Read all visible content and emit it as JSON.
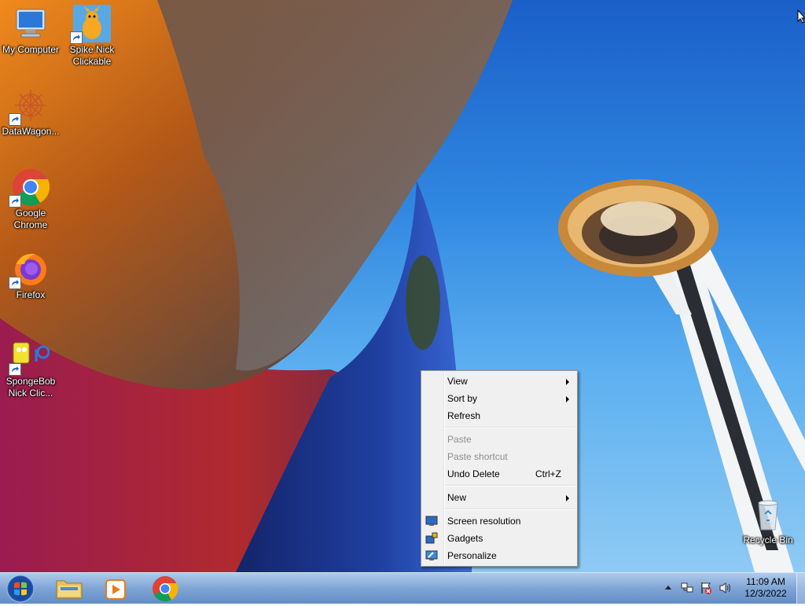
{
  "desktop": {
    "icons": [
      {
        "id": "my-computer",
        "label": "My Computer"
      },
      {
        "id": "spike-nick",
        "label": "Spike Nick\nClickable"
      },
      {
        "id": "datawagon",
        "label": "DataWagon..."
      },
      {
        "id": "google-chrome",
        "label": "Google\nChrome"
      },
      {
        "id": "firefox",
        "label": "Firefox"
      },
      {
        "id": "spongebob",
        "label": "SpongeBob\nNick Clic..."
      },
      {
        "id": "recycle-bin",
        "label": "Recycle Bin"
      }
    ]
  },
  "context_menu": {
    "items": [
      {
        "label": "View",
        "submenu": true
      },
      {
        "label": "Sort by",
        "submenu": true
      },
      {
        "label": "Refresh"
      },
      {
        "label": "Paste",
        "disabled": true
      },
      {
        "label": "Paste shortcut",
        "disabled": true
      },
      {
        "label": "Undo Delete",
        "shortcut": "Ctrl+Z"
      },
      {
        "label": "New",
        "submenu": true
      },
      {
        "label": "Screen resolution",
        "icon": "monitor-icon"
      },
      {
        "label": "Gadgets",
        "icon": "gadgets-icon"
      },
      {
        "label": "Personalize",
        "icon": "personalize-icon"
      }
    ]
  },
  "taskbar": {
    "pinned": [
      {
        "name": "windows-explorer",
        "icon": "folder-icon"
      },
      {
        "name": "windows-media-player",
        "icon": "media-player-icon"
      },
      {
        "name": "google-chrome",
        "icon": "chrome-icon"
      }
    ],
    "tray_icons": [
      "show-hidden-icons-icon",
      "network-icon",
      "action-center-icon",
      "volume-icon"
    ],
    "clock": {
      "time": "11:09 AM",
      "date": "12/3/2022"
    }
  }
}
